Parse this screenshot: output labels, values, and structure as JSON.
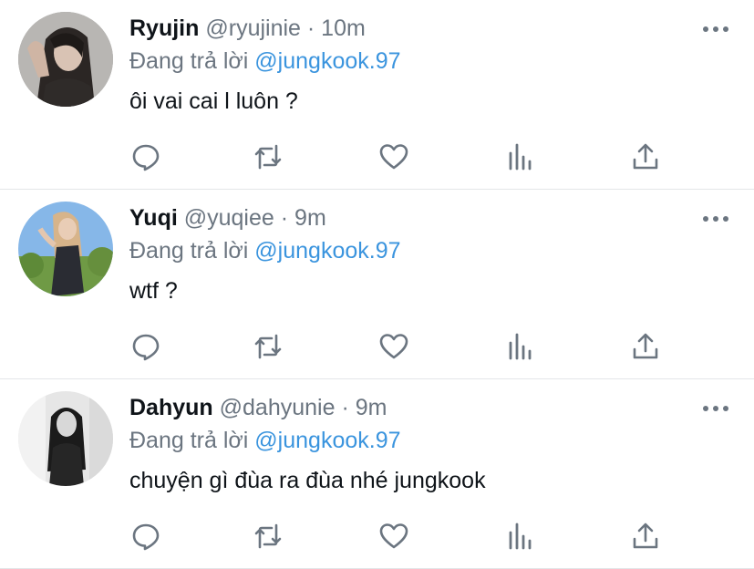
{
  "reply_prefix": "Đang trả lời",
  "colors": {
    "name": "#0f1419",
    "meta": "#6b7580",
    "mention": "#3a94de",
    "divider": "#e3e6e8"
  },
  "icons": [
    "more-icon",
    "reply-icon",
    "retweet-icon",
    "like-icon",
    "stats-icon",
    "share-icon"
  ],
  "tweets": [
    {
      "name": "Ryujin",
      "handle": "@ryujinie",
      "separator": "·",
      "time": "10m",
      "reply_to": "@jungkook.97",
      "text": "ôi vai cai l luôn ?"
    },
    {
      "name": "Yuqi",
      "handle": "@yuqiee",
      "separator": "·",
      "time": "9m",
      "reply_to": "@jungkook.97",
      "text": "wtf ?"
    },
    {
      "name": "Dahyun",
      "handle": "@dahyunie",
      "separator": "·",
      "time": "9m",
      "reply_to": "@jungkook.97",
      "text": "chuyện gì đùa ra đùa nhé jungkook"
    }
  ]
}
